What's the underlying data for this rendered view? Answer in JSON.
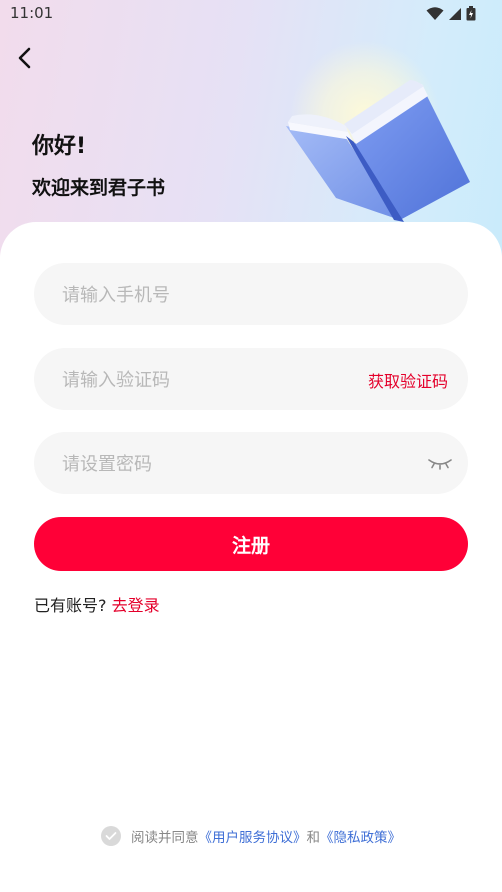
{
  "status_bar": {
    "time": "11:01"
  },
  "header": {
    "greeting": "你好!",
    "welcome": "欢迎来到君子书"
  },
  "form": {
    "phone_placeholder": "请输入手机号",
    "code_placeholder": "请输入验证码",
    "get_code_label": "获取验证码",
    "password_placeholder": "请设置密码",
    "register_label": "注册"
  },
  "login_prompt": {
    "text": "已有账号?",
    "link": "去登录"
  },
  "agreement": {
    "prefix": "阅读并同意",
    "terms": "《用户服务协议》",
    "and": "和",
    "privacy": "《隐私政策》"
  },
  "colors": {
    "accent": "#ff0037",
    "link_red": "#e4002b",
    "link_blue": "#3f6fd6"
  },
  "icons": [
    "back-icon",
    "wifi-icon",
    "signal-icon",
    "battery-icon",
    "eye-closed-icon",
    "check-icon",
    "book-illustration"
  ]
}
